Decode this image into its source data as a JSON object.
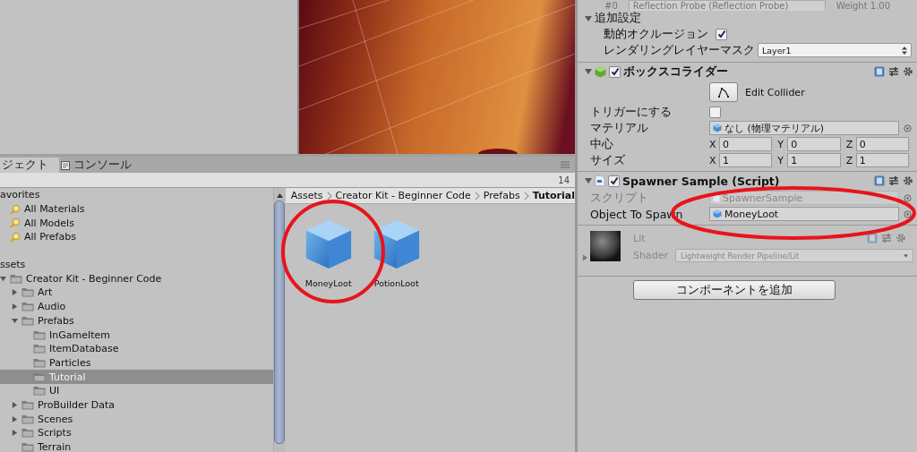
{
  "inspector": {
    "probe_row": {
      "index": "#0",
      "probe": "Reflection Probe (Reflection Probe)",
      "weight": "Weight 1.00"
    },
    "additional_settings": {
      "title": "追加設定",
      "expanded": true,
      "fields": [
        {
          "kind": "checkbox",
          "label": "動的オクルージョン",
          "checked": true
        },
        {
          "kind": "dropdown",
          "label": "レンダリングレイヤーマスク",
          "value": "Layer1"
        }
      ]
    },
    "components": [
      {
        "kind": "collider",
        "title": "ボックスコライダー",
        "enabled": true,
        "expanded": true,
        "edit_button": "Edit Collider",
        "fields": [
          {
            "kind": "checkbox",
            "label": "トリガーにする",
            "checked": false
          },
          {
            "kind": "object",
            "label": "マテリアル",
            "value": "なし (物理マテリアル)",
            "disabled": false
          },
          {
            "kind": "vector3",
            "label": "中心",
            "axes": [
              {
                "axis": "X",
                "value": "0"
              },
              {
                "axis": "Y",
                "value": "0"
              },
              {
                "axis": "Z",
                "value": "0"
              }
            ]
          },
          {
            "kind": "vector3",
            "label": "サイズ",
            "axes": [
              {
                "axis": "X",
                "value": "1"
              },
              {
                "axis": "Y",
                "value": "1"
              },
              {
                "axis": "Z",
                "value": "1"
              }
            ]
          }
        ]
      },
      {
        "kind": "script",
        "title": "Spawner Sample (Script)",
        "enabled": true,
        "expanded": true,
        "fields": [
          {
            "kind": "script",
            "label": "スクリプト",
            "value": "SpawnerSample",
            "disabled": true
          },
          {
            "kind": "object",
            "label": "Object To Spawn",
            "value": "MoneyLoot",
            "disabled": false
          }
        ]
      }
    ],
    "material": {
      "name": "Lit",
      "shader_label": "Shader",
      "shader": "Lightweight Render Pipeline/Lit"
    },
    "add_component": "コンポーネントを追加"
  },
  "project": {
    "tabs": [
      {
        "label": "ジェクト",
        "selected": true
      },
      {
        "label": "コンソール",
        "selected": false
      }
    ],
    "count": "14",
    "tree": [
      {
        "kind": "header",
        "label": "avorites",
        "selected": false,
        "children": [
          {
            "kind": "search",
            "label": "All Materials",
            "selected": false
          },
          {
            "kind": "search",
            "label": "All Models",
            "selected": false
          },
          {
            "kind": "search",
            "label": "All Prefabs",
            "selected": false
          }
        ]
      },
      {
        "kind": "header",
        "label": "ssets",
        "selected": false,
        "children": [
          {
            "kind": "folder",
            "label": "Creator Kit - Beginner Code",
            "expanded": true,
            "selected": false,
            "children": [
              {
                "kind": "folder",
                "label": "Art",
                "expanded": false,
                "selected": false
              },
              {
                "kind": "folder",
                "label": "Audio",
                "expanded": false,
                "selected": false
              },
              {
                "kind": "folder",
                "label": "Prefabs",
                "expanded": true,
                "selected": false,
                "children": [
                  {
                    "kind": "folder",
                    "label": "InGameItem",
                    "selected": false
                  },
                  {
                    "kind": "folder",
                    "label": "ItemDatabase",
                    "selected": false
                  },
                  {
                    "kind": "folder",
                    "label": "Particles",
                    "selected": false
                  },
                  {
                    "kind": "folder",
                    "label": "Tutorial",
                    "selected": true
                  },
                  {
                    "kind": "folder",
                    "label": "UI",
                    "selected": false
                  }
                ]
              },
              {
                "kind": "folder",
                "label": "ProBuilder Data",
                "expanded": false,
                "selected": false
              },
              {
                "kind": "folder",
                "label": "Scenes",
                "expanded": false,
                "selected": false
              },
              {
                "kind": "folder",
                "label": "Scripts",
                "expanded": false,
                "selected": false
              },
              {
                "kind": "folder",
                "label": "Terrain",
                "selected": false
              }
            ]
          }
        ]
      }
    ],
    "breadcrumb": [
      "Assets",
      "Creator Kit - Beginner Code",
      "Prefabs",
      "Tutorial"
    ],
    "assets": [
      {
        "name": "MoneyLoot"
      },
      {
        "name": "PotionLoot"
      }
    ]
  }
}
